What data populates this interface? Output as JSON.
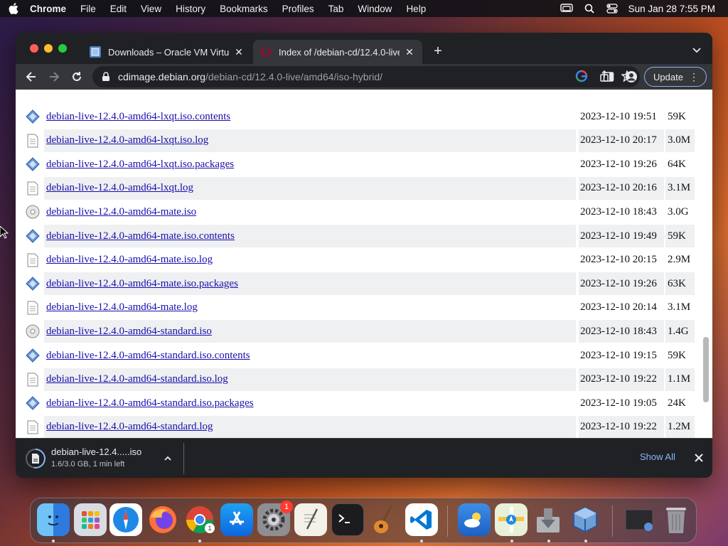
{
  "menubar": {
    "app_name": "Chrome",
    "items": [
      "File",
      "Edit",
      "View",
      "History",
      "Bookmarks",
      "Profiles",
      "Tab",
      "Window",
      "Help"
    ],
    "clock": "Sun Jan 28  7:55 PM"
  },
  "tabs": [
    {
      "title": "Downloads – Oracle VM Virtual",
      "icon": "virtualbox-favicon",
      "active": false
    },
    {
      "title": "Index of /debian-cd/12.4.0-live",
      "icon": "debian-favicon",
      "active": true
    }
  ],
  "toolbar": {
    "url_host": "cdimage.debian.org",
    "url_path": "/debian-cd/12.4.0-live/amd64/iso-hybrid/",
    "update_label": "Update"
  },
  "listing": {
    "rows": [
      {
        "name": "debian-live-12.4.0-amd64-lxqt.iso.contents",
        "date": "2023-12-10 19:51",
        "size": "59K",
        "icon": "contents-icon"
      },
      {
        "name": "debian-live-12.4.0-amd64-lxqt.iso.log",
        "date": "2023-12-10 20:17",
        "size": "3.0M",
        "icon": "text-file-icon"
      },
      {
        "name": "debian-live-12.4.0-amd64-lxqt.iso.packages",
        "date": "2023-12-10 19:26",
        "size": "64K",
        "icon": "contents-icon"
      },
      {
        "name": "debian-live-12.4.0-amd64-lxqt.log",
        "date": "2023-12-10 20:16",
        "size": "3.1M",
        "icon": "text-file-icon"
      },
      {
        "name": "debian-live-12.4.0-amd64-mate.iso",
        "date": "2023-12-10 18:43",
        "size": "3.0G",
        "icon": "disc-icon"
      },
      {
        "name": "debian-live-12.4.0-amd64-mate.iso.contents",
        "date": "2023-12-10 19:49",
        "size": "59K",
        "icon": "contents-icon"
      },
      {
        "name": "debian-live-12.4.0-amd64-mate.iso.log",
        "date": "2023-12-10 20:15",
        "size": "2.9M",
        "icon": "text-file-icon"
      },
      {
        "name": "debian-live-12.4.0-amd64-mate.iso.packages",
        "date": "2023-12-10 19:26",
        "size": "63K",
        "icon": "contents-icon"
      },
      {
        "name": "debian-live-12.4.0-amd64-mate.log",
        "date": "2023-12-10 20:14",
        "size": "3.1M",
        "icon": "text-file-icon"
      },
      {
        "name": "debian-live-12.4.0-amd64-standard.iso",
        "date": "2023-12-10 18:43",
        "size": "1.4G",
        "icon": "disc-icon"
      },
      {
        "name": "debian-live-12.4.0-amd64-standard.iso.contents",
        "date": "2023-12-10 19:15",
        "size": "59K",
        "icon": "contents-icon"
      },
      {
        "name": "debian-live-12.4.0-amd64-standard.iso.log",
        "date": "2023-12-10 19:22",
        "size": "1.1M",
        "icon": "text-file-icon"
      },
      {
        "name": "debian-live-12.4.0-amd64-standard.iso.packages",
        "date": "2023-12-10 19:05",
        "size": "24K",
        "icon": "contents-icon"
      },
      {
        "name": "debian-live-12.4.0-amd64-standard.log",
        "date": "2023-12-10 19:22",
        "size": "1.2M",
        "icon": "text-file-icon"
      }
    ]
  },
  "download_shelf": {
    "file_name": "debian-live-12.4.....iso",
    "status": "1.6/3.0 GB, 1 min left",
    "progress": 0.53,
    "show_all_label": "Show All"
  },
  "dock": {
    "apps": [
      "finder-icon",
      "launchpad-icon",
      "safari-icon",
      "firefox-icon",
      "chrome-icon",
      "app-store-icon",
      "system-settings-icon",
      "textedit-icon",
      "terminal-icon",
      "garageband-icon",
      "vscode-icon",
      "weather-icon",
      "maps-icon",
      "installer-icon",
      "virtualbox-icon",
      "screenshot-folder-icon",
      "trash-icon"
    ],
    "settings_badge": "1",
    "chrome_badge": "1"
  },
  "colors": {
    "link": "#1a0dab",
    "accent": "#8ab4f8",
    "window_bg": "#202124"
  }
}
